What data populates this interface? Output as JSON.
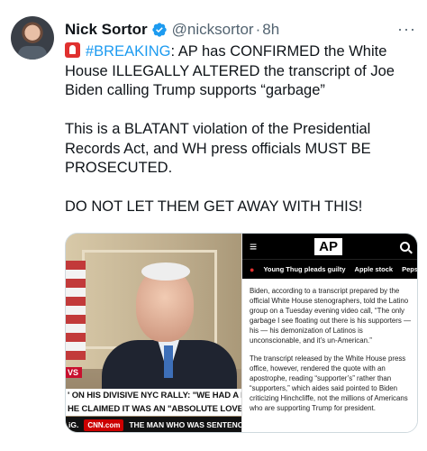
{
  "tweet": {
    "author_name": "Nick Sortor",
    "handle": "@nicksortor",
    "separator": "·",
    "time": "8h",
    "more": "···",
    "paragraph1_hashtag": "#BREAKING",
    "paragraph1_text": ": AP has CONFIRMED the White House ILLEGALLY ALTERED the transcript of Joe Biden calling Trump supports “garbage”",
    "paragraph2": "This is a BLATANT violation of the Presidential Records Act, and WH press officials MUST BE PROSECUTED.",
    "paragraph3": "DO NOT LET THEM GET AWAY WITH THIS!"
  },
  "video": {
    "corner_label": "VS",
    "chyron_line1": "' ON HIS DIVISIVE NYC RALLY: \"WE HAD A E",
    "chyron_line2": "HE CLAIMED IT WAS AN \"ABSOLUTE LOVEF",
    "ticker_left": "iG.",
    "network": "CNN.com",
    "ticker_text": "THE MAN WHO WAS SENTENCED TO"
  },
  "article": {
    "logo": "AP",
    "menu_icon": "≡",
    "topics": [
      "Young Thug pleads guilty",
      "Apple stock",
      "Pepsi, Cele"
    ],
    "paragraph1": "Biden, according to a transcript prepared by the official White House stenographers, told the Latino group on a Tuesday evening video call, “The only garbage I see floating out there is his supporters — his — his demonization of Latinos is unconscionable, and it’s un-American.”",
    "paragraph2": "The transcript released by the White House press office, however, rendered the quote with an apostrophe, reading “supporter’s” rather than “supporters,” which aides said pointed to Biden criticizing Hinchcliffe, not the millions of Americans who are supporting Trump for president."
  },
  "colors": {
    "verified_blue": "#1d9bf0",
    "hashtag_blue": "#1d9bf0",
    "secondary_text": "#536471",
    "breaking_red": "#e0312f"
  },
  "icons": [
    "avatar",
    "verified-badge-icon",
    "more-icon",
    "siren-icon",
    "hamburger-menu-icon",
    "search-icon"
  ]
}
